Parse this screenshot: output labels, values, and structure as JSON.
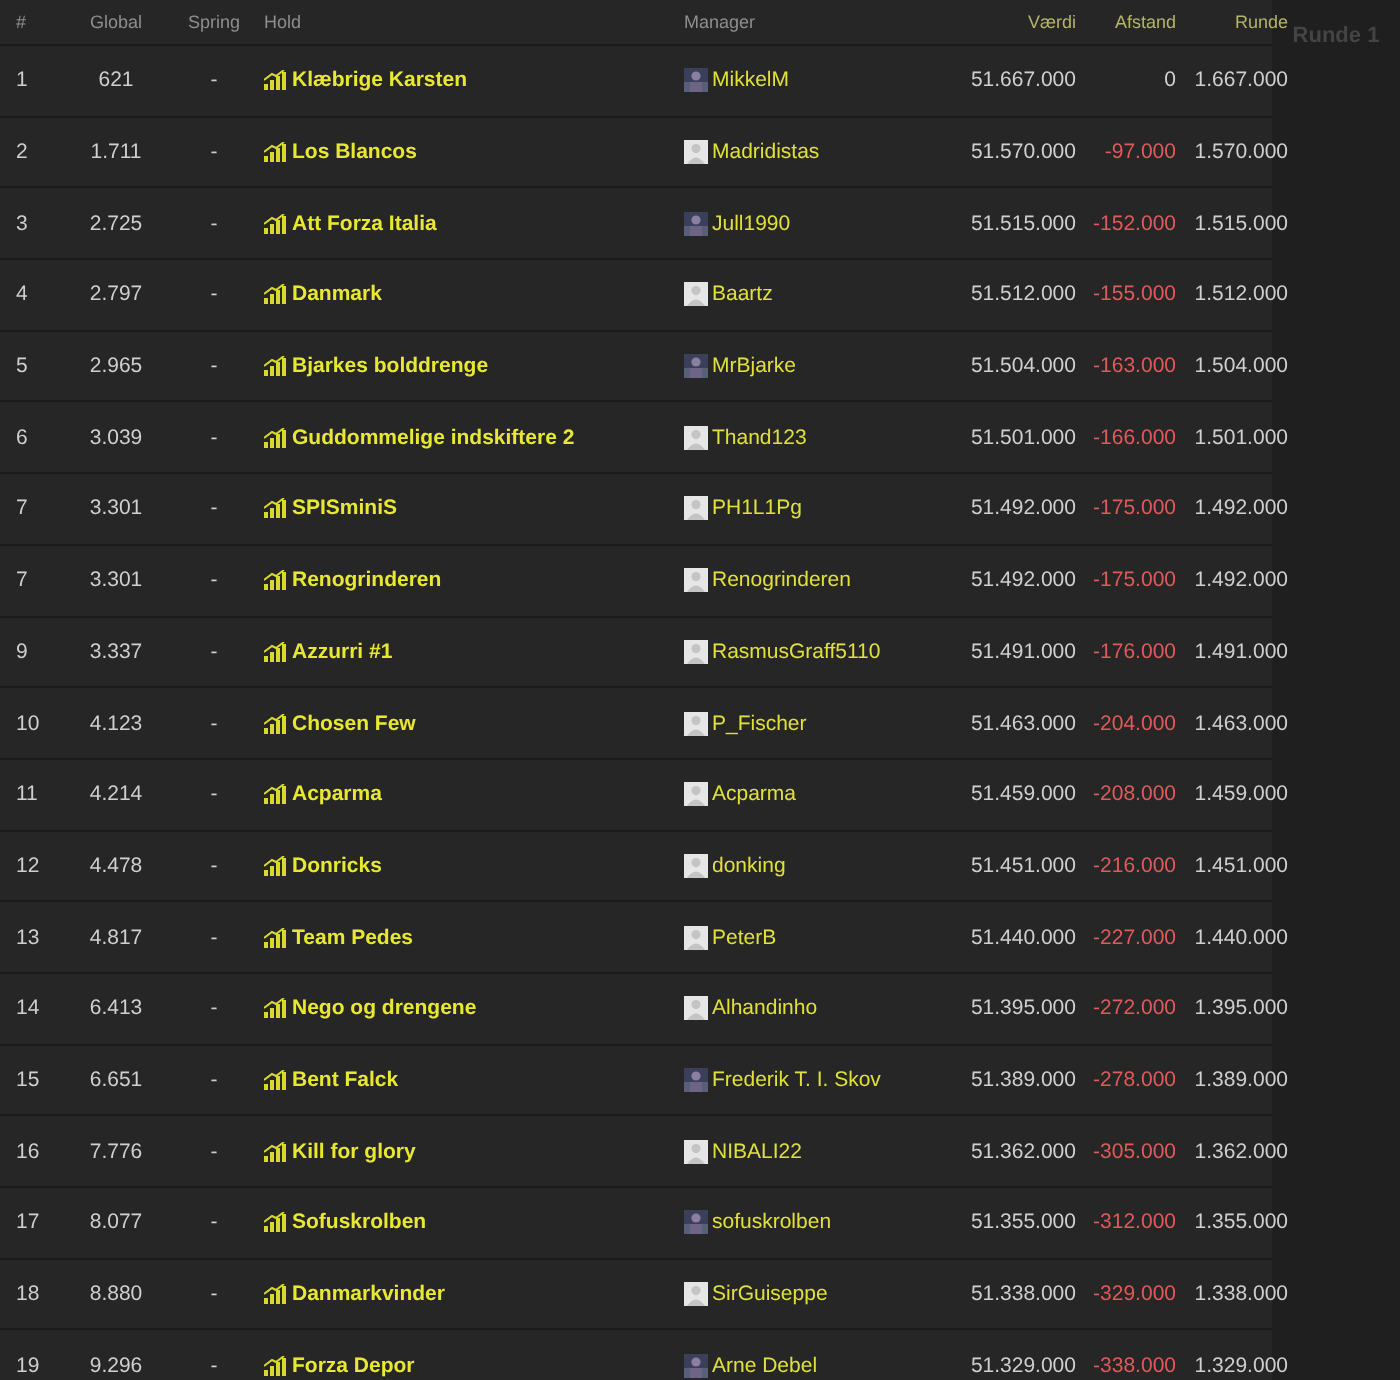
{
  "columns": [
    {
      "label": "#",
      "kind": "plain"
    },
    {
      "label": "Global",
      "kind": "plain"
    },
    {
      "label": "Spring",
      "kind": "plain"
    },
    {
      "label": "Hold",
      "kind": "plain"
    },
    {
      "label": "Manager",
      "kind": "plain"
    },
    {
      "label": "Værdi",
      "kind": "accent"
    },
    {
      "label": "Afstand",
      "kind": "accent"
    },
    {
      "label": "Runde",
      "kind": "accent"
    }
  ],
  "side_heading": "Runde 1",
  "rows": [
    {
      "rank": "1",
      "global": "621",
      "spring": "-",
      "team": "Klæbrige Karsten",
      "manager": "MikkelM",
      "avatar": {
        "kind": "photo"
      },
      "value": "51.667.000",
      "gap": {
        "text": "0",
        "color": "#d0d0d0"
      },
      "round": "1.667.000"
    },
    {
      "rank": "2",
      "global": "1.711",
      "spring": "-",
      "team": "Los Blancos",
      "manager": "Madridistas",
      "avatar": {
        "kind": "default"
      },
      "value": "51.570.000",
      "gap": {
        "text": "-97.000",
        "color": "#e05a5a"
      },
      "round": "1.570.000"
    },
    {
      "rank": "3",
      "global": "2.725",
      "spring": "-",
      "team": "Att Forza Italia",
      "manager": "Jull1990",
      "avatar": {
        "kind": "photo"
      },
      "value": "51.515.000",
      "gap": {
        "text": "-152.000",
        "color": "#e05a5a"
      },
      "round": "1.515.000"
    },
    {
      "rank": "4",
      "global": "2.797",
      "spring": "-",
      "team": "Danmark",
      "manager": "Baartz",
      "avatar": {
        "kind": "default"
      },
      "value": "51.512.000",
      "gap": {
        "text": "-155.000",
        "color": "#e05a5a"
      },
      "round": "1.512.000"
    },
    {
      "rank": "5",
      "global": "2.965",
      "spring": "-",
      "team": "Bjarkes bolddrenge",
      "manager": "MrBjarke",
      "avatar": {
        "kind": "photo"
      },
      "value": "51.504.000",
      "gap": {
        "text": "-163.000",
        "color": "#e05a5a"
      },
      "round": "1.504.000"
    },
    {
      "rank": "6",
      "global": "3.039",
      "spring": "-",
      "team": "Guddommelige indskiftere 2",
      "manager": "Thand123",
      "avatar": {
        "kind": "default"
      },
      "value": "51.501.000",
      "gap": {
        "text": "-166.000",
        "color": "#e05a5a"
      },
      "round": "1.501.000"
    },
    {
      "rank": "7",
      "global": "3.301",
      "spring": "-",
      "team": "SPISminiS",
      "manager": "PH1L1Pg",
      "avatar": {
        "kind": "default"
      },
      "value": "51.492.000",
      "gap": {
        "text": "-175.000",
        "color": "#e05a5a"
      },
      "round": "1.492.000"
    },
    {
      "rank": "7",
      "global": "3.301",
      "spring": "-",
      "team": "Renogrinderen",
      "manager": "Renogrinderen",
      "avatar": {
        "kind": "default"
      },
      "value": "51.492.000",
      "gap": {
        "text": "-175.000",
        "color": "#e05a5a"
      },
      "round": "1.492.000"
    },
    {
      "rank": "9",
      "global": "3.337",
      "spring": "-",
      "team": "Azzurri #1",
      "manager": "RasmusGraff5110",
      "avatar": {
        "kind": "default"
      },
      "value": "51.491.000",
      "gap": {
        "text": "-176.000",
        "color": "#e05a5a"
      },
      "round": "1.491.000"
    },
    {
      "rank": "10",
      "global": "4.123",
      "spring": "-",
      "team": "Chosen Few",
      "manager": "P_Fischer",
      "avatar": {
        "kind": "default"
      },
      "value": "51.463.000",
      "gap": {
        "text": "-204.000",
        "color": "#e05a5a"
      },
      "round": "1.463.000"
    },
    {
      "rank": "11",
      "global": "4.214",
      "spring": "-",
      "team": "Acparma",
      "manager": "Acparma",
      "avatar": {
        "kind": "default"
      },
      "value": "51.459.000",
      "gap": {
        "text": "-208.000",
        "color": "#e05a5a"
      },
      "round": "1.459.000"
    },
    {
      "rank": "12",
      "global": "4.478",
      "spring": "-",
      "team": "Donricks",
      "manager": "donking",
      "avatar": {
        "kind": "default"
      },
      "value": "51.451.000",
      "gap": {
        "text": "-216.000",
        "color": "#e05a5a"
      },
      "round": "1.451.000"
    },
    {
      "rank": "13",
      "global": "4.817",
      "spring": "-",
      "team": "Team Pedes",
      "manager": "PeterB",
      "avatar": {
        "kind": "default"
      },
      "value": "51.440.000",
      "gap": {
        "text": "-227.000",
        "color": "#e05a5a"
      },
      "round": "1.440.000"
    },
    {
      "rank": "14",
      "global": "6.413",
      "spring": "-",
      "team": "Nego og drengene",
      "manager": "Alhandinho",
      "avatar": {
        "kind": "default"
      },
      "value": "51.395.000",
      "gap": {
        "text": "-272.000",
        "color": "#e05a5a"
      },
      "round": "1.395.000"
    },
    {
      "rank": "15",
      "global": "6.651",
      "spring": "-",
      "team": "Bent Falck",
      "manager": "Frederik T. I. Skov",
      "avatar": {
        "kind": "photo"
      },
      "value": "51.389.000",
      "gap": {
        "text": "-278.000",
        "color": "#e05a5a"
      },
      "round": "1.389.000"
    },
    {
      "rank": "16",
      "global": "7.776",
      "spring": "-",
      "team": "Kill for glory",
      "manager": "NIBALI22",
      "avatar": {
        "kind": "default"
      },
      "value": "51.362.000",
      "gap": {
        "text": "-305.000",
        "color": "#e05a5a"
      },
      "round": "1.362.000"
    },
    {
      "rank": "17",
      "global": "8.077",
      "spring": "-",
      "team": "Sofuskrolben",
      "manager": "sofuskrolben",
      "avatar": {
        "kind": "photo"
      },
      "value": "51.355.000",
      "gap": {
        "text": "-312.000",
        "color": "#e05a5a"
      },
      "round": "1.355.000"
    },
    {
      "rank": "18",
      "global": "8.880",
      "spring": "-",
      "team": "Danmarkvinder",
      "manager": "SirGuiseppe",
      "avatar": {
        "kind": "default"
      },
      "value": "51.338.000",
      "gap": {
        "text": "-329.000",
        "color": "#e05a5a"
      },
      "round": "1.338.000"
    },
    {
      "rank": "19",
      "global": "9.296",
      "spring": "-",
      "team": "Forza Depor",
      "manager": "Arne Debel",
      "avatar": {
        "kind": "photo"
      },
      "value": "51.329.000",
      "gap": {
        "text": "-338.000",
        "color": "#e05a5a"
      },
      "round": "1.329.000"
    }
  ]
}
